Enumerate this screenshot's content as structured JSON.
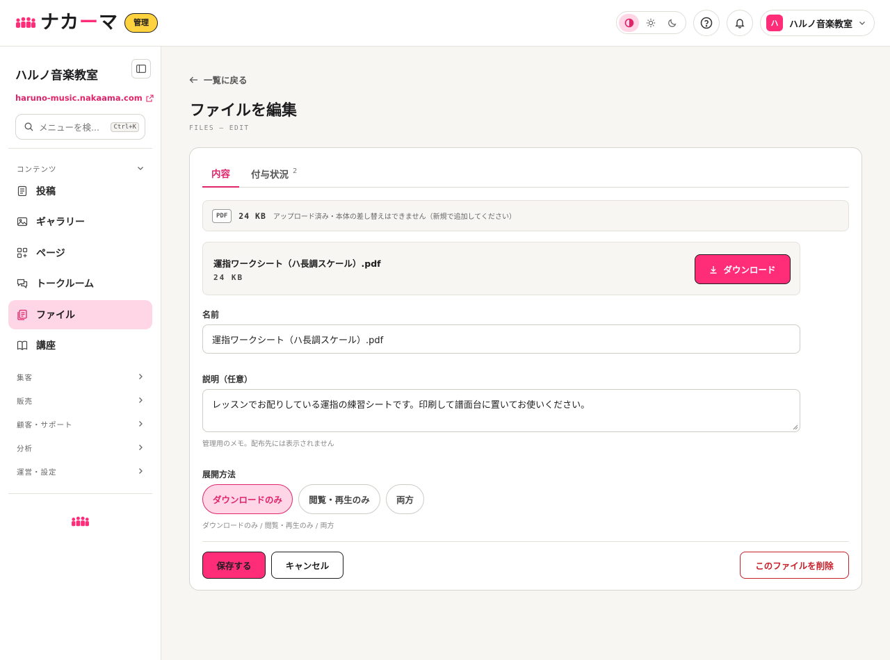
{
  "header": {
    "logo_text_pre": "ナカ",
    "logo_dash": "ー",
    "logo_text_post": "マ",
    "admin_badge": "管理",
    "theme_options": [
      "contrast-icon",
      "sun-icon",
      "moon-icon"
    ],
    "account_avatar": "ハ",
    "account_name": "ハルノ音楽教室"
  },
  "sidebar": {
    "org_name": "ハルノ音楽教室",
    "site_link": "haruno-music.nakaama.com",
    "search_placeholder": "メニューを検...",
    "search_shortcut": "Ctrl+K",
    "content_section": "コンテンツ",
    "items": [
      {
        "label": "投稿",
        "icon": "document-icon"
      },
      {
        "label": "ギャラリー",
        "icon": "image-icon"
      },
      {
        "label": "ページ",
        "icon": "pages-icon"
      },
      {
        "label": "トークルーム",
        "icon": "chat-icon"
      },
      {
        "label": "ファイル",
        "icon": "files-icon",
        "active": true
      },
      {
        "label": "講座",
        "icon": "book-icon"
      }
    ],
    "sections": [
      "集客",
      "販売",
      "顧客・サポート",
      "分析",
      "運営・設定"
    ]
  },
  "main": {
    "back_link": "一覧に戻る",
    "title": "ファイルを編集",
    "subtitle": "FILES — EDIT",
    "tabs": [
      {
        "label": "内容",
        "active": true
      },
      {
        "label": "付与状況",
        "count": "2"
      }
    ],
    "info": {
      "type": "PDF",
      "size": "24 KB",
      "note": "アップロード済み・本体の差し替えはできません（新規で追加してください）"
    },
    "file": {
      "name": "運指ワークシート（ハ長調スケール）.pdf",
      "size": "24 KB",
      "download_label": "ダウンロード"
    },
    "name_label": "名前",
    "name_value": "運指ワークシート（ハ長調スケール）.pdf",
    "description_label": "説明（任意）",
    "description_value": "レッスンでお配りしている運指の練習シートです。印刷して譜面台に置いてお使いください。",
    "description_help": "管理用のメモ。配布先には表示されません",
    "delivery_label": "展開方法",
    "delivery_options": [
      {
        "label": "ダウンロードのみ",
        "selected": true
      },
      {
        "label": "閲覧・再生のみ"
      },
      {
        "label": "両方"
      }
    ],
    "delivery_help": "ダウンロードのみ / 閲覧・再生のみ / 両方",
    "save_label": "保存する",
    "cancel_label": "キャンセル",
    "delete_label": "このファイルを削除"
  },
  "colors": {
    "accent": "#ff2d78",
    "accent_text": "#e0246a",
    "accent_soft": "#ffd6e6",
    "badge": "#ffd23f",
    "danger": "#c8202a"
  }
}
